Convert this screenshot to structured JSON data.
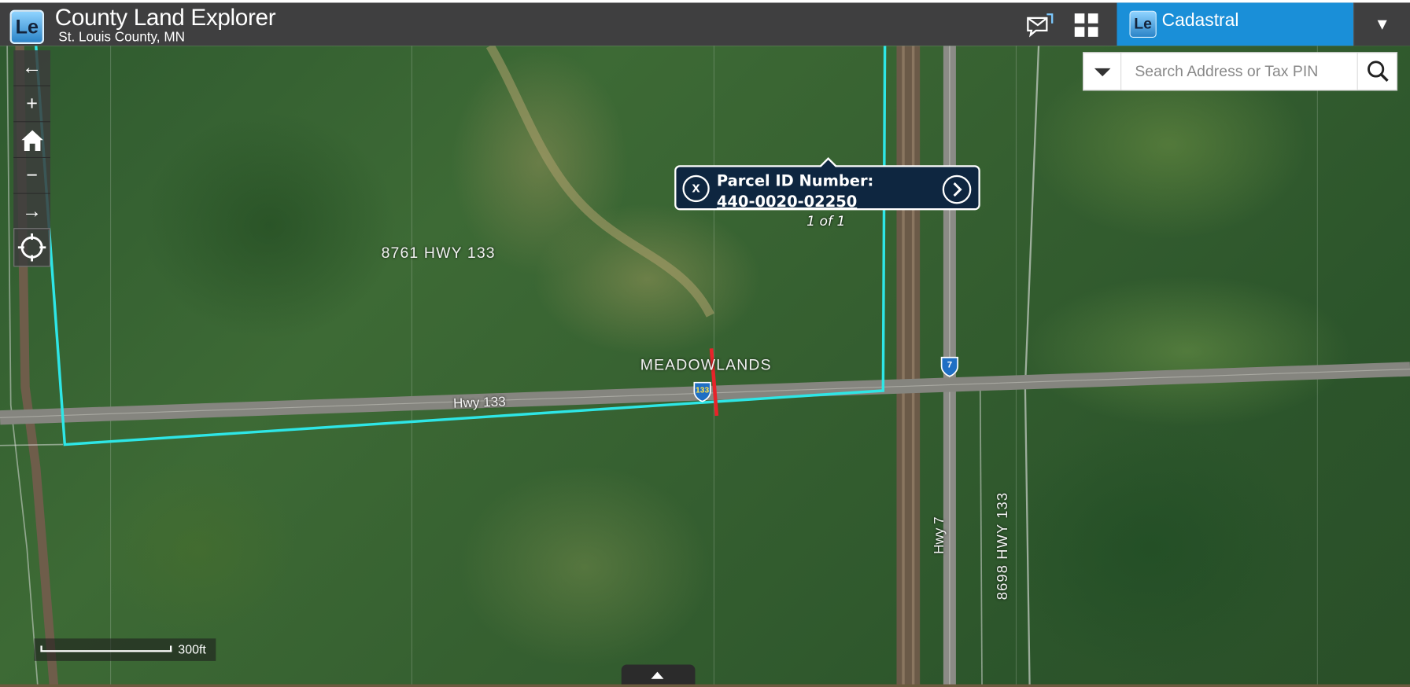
{
  "header": {
    "logo_text": "Le",
    "title": "County Land Explorer",
    "subtitle": "St. Louis County, MN",
    "feedback_icon": "mail-feedback-icon",
    "apps_icon": "grid-apps-icon"
  },
  "theme": {
    "logo_text": "Le",
    "label": "Cadastral",
    "menu_icon": "▼"
  },
  "search": {
    "placeholder": "Search Address or Tax PIN",
    "value": ""
  },
  "nav": {
    "back": "←",
    "zoom_in": "+",
    "home": "home-icon",
    "zoom_out": "−",
    "forward": "→",
    "locate": "locate-icon"
  },
  "map": {
    "labels": {
      "address_1": "8761 HWY 133",
      "place": "MEADOWLANDS",
      "road_1": "Hwy 133",
      "road_2": "Hwy 7",
      "address_2": "8698 HWY 133"
    },
    "shields": {
      "hwy_133": "133",
      "hwy_7": "7"
    },
    "parcel_color": "#2ee6e6",
    "selection_color": "#e8242a"
  },
  "popup": {
    "title": "Parcel ID Number:",
    "value": "440-0020-02250",
    "count": "1 of 1"
  },
  "scale": {
    "label": "300ft"
  },
  "colors": {
    "header_bg": "#3f3f40",
    "theme_bg": "#1a8fd8",
    "popup_bg": "#0e2640"
  }
}
